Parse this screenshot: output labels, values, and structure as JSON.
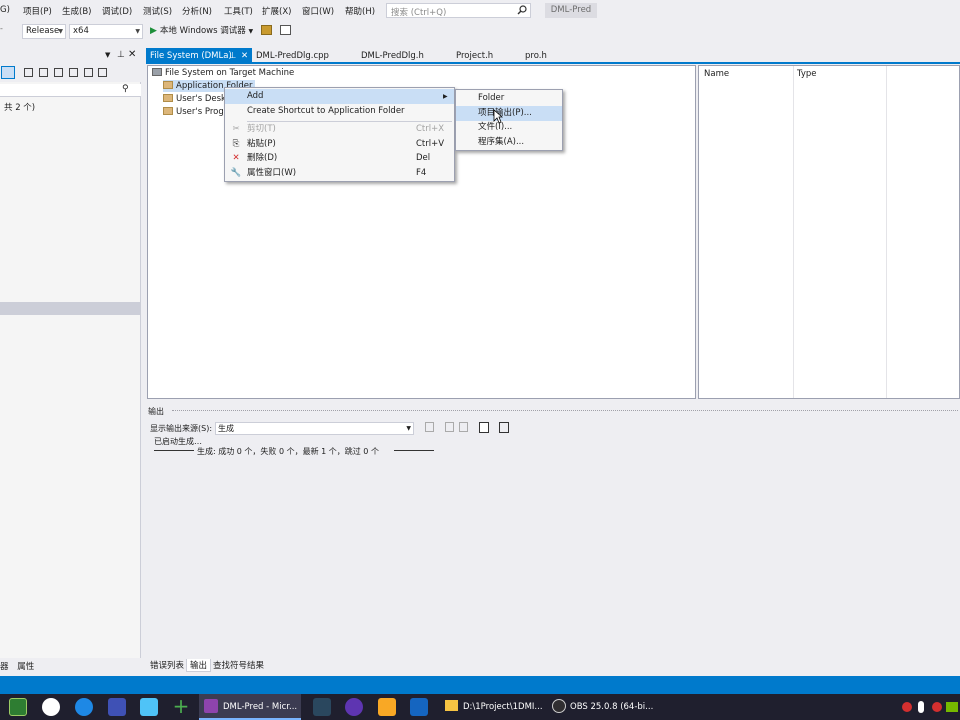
{
  "menubar": {
    "items": [
      "G)",
      "项目(P)",
      "生成(B)",
      "调试(D)",
      "测试(S)",
      "分析(N)",
      "工具(T)",
      "扩展(X)",
      "窗口(W)",
      "帮助(H)"
    ],
    "search_placeholder": "搜索 (Ctrl+Q)",
    "project_name": "DML-Pred"
  },
  "toolbar": {
    "configuration": "Release",
    "platform": "x64",
    "run_label": "本地 Windows 调试器"
  },
  "left_panel": {
    "count_label": "共 2 个)"
  },
  "doc_tabs": [
    {
      "label": "File System (DMLa)",
      "active": true
    },
    {
      "label": "DML-PredDlg.cpp",
      "active": false
    },
    {
      "label": "DML-PredDlg.h",
      "active": false
    },
    {
      "label": "Project.h",
      "active": false
    },
    {
      "label": "pro.h",
      "active": false
    }
  ],
  "fs_tree": {
    "root": "File System on Target Machine",
    "children": [
      "Application Folder",
      "User's Desk",
      "User's Progr"
    ]
  },
  "fs_list": {
    "columns": [
      "Name",
      "Type"
    ]
  },
  "context_menu": {
    "items": [
      {
        "label": "Add",
        "shortcut": "",
        "submenu": true
      },
      {
        "label": "Create Shortcut to Application Folder",
        "shortcut": ""
      },
      {
        "label": "剪切(T)",
        "shortcut": "Ctrl+X",
        "disabled": true,
        "icon": "scissors-icon"
      },
      {
        "label": "粘贴(P)",
        "shortcut": "Ctrl+V",
        "icon": "paste-icon"
      },
      {
        "label": "删除(D)",
        "shortcut": "Del",
        "icon": "delete-icon"
      },
      {
        "label": "属性窗口(W)",
        "shortcut": "F4",
        "icon": "wrench-icon"
      }
    ]
  },
  "submenu": {
    "items": [
      "Folder",
      "项目输出(P)...",
      "文件(I)...",
      "程序集(A)..."
    ]
  },
  "output": {
    "title": "输出",
    "source_label": "显示输出来源(S):",
    "source_value": "生成",
    "line1": "已启动生成…",
    "line2": "生成: 成功 0 个，失败 0 个，最新 1 个，跳过 0 个"
  },
  "bottom_tabs": [
    "错误列表",
    "输出",
    "查找符号结果"
  ],
  "left_bottom_tabs": [
    "器",
    "属性"
  ],
  "taskbar": {
    "items": [
      "DML-Pred - Micr...",
      "D:\\1Project\\1DMI...",
      "OBS 25.0.8 (64-bi..."
    ]
  },
  "colors": {
    "accent": "#007acc",
    "menu_highlight": "#c9def5",
    "taskbar": "#1f1f2e"
  }
}
